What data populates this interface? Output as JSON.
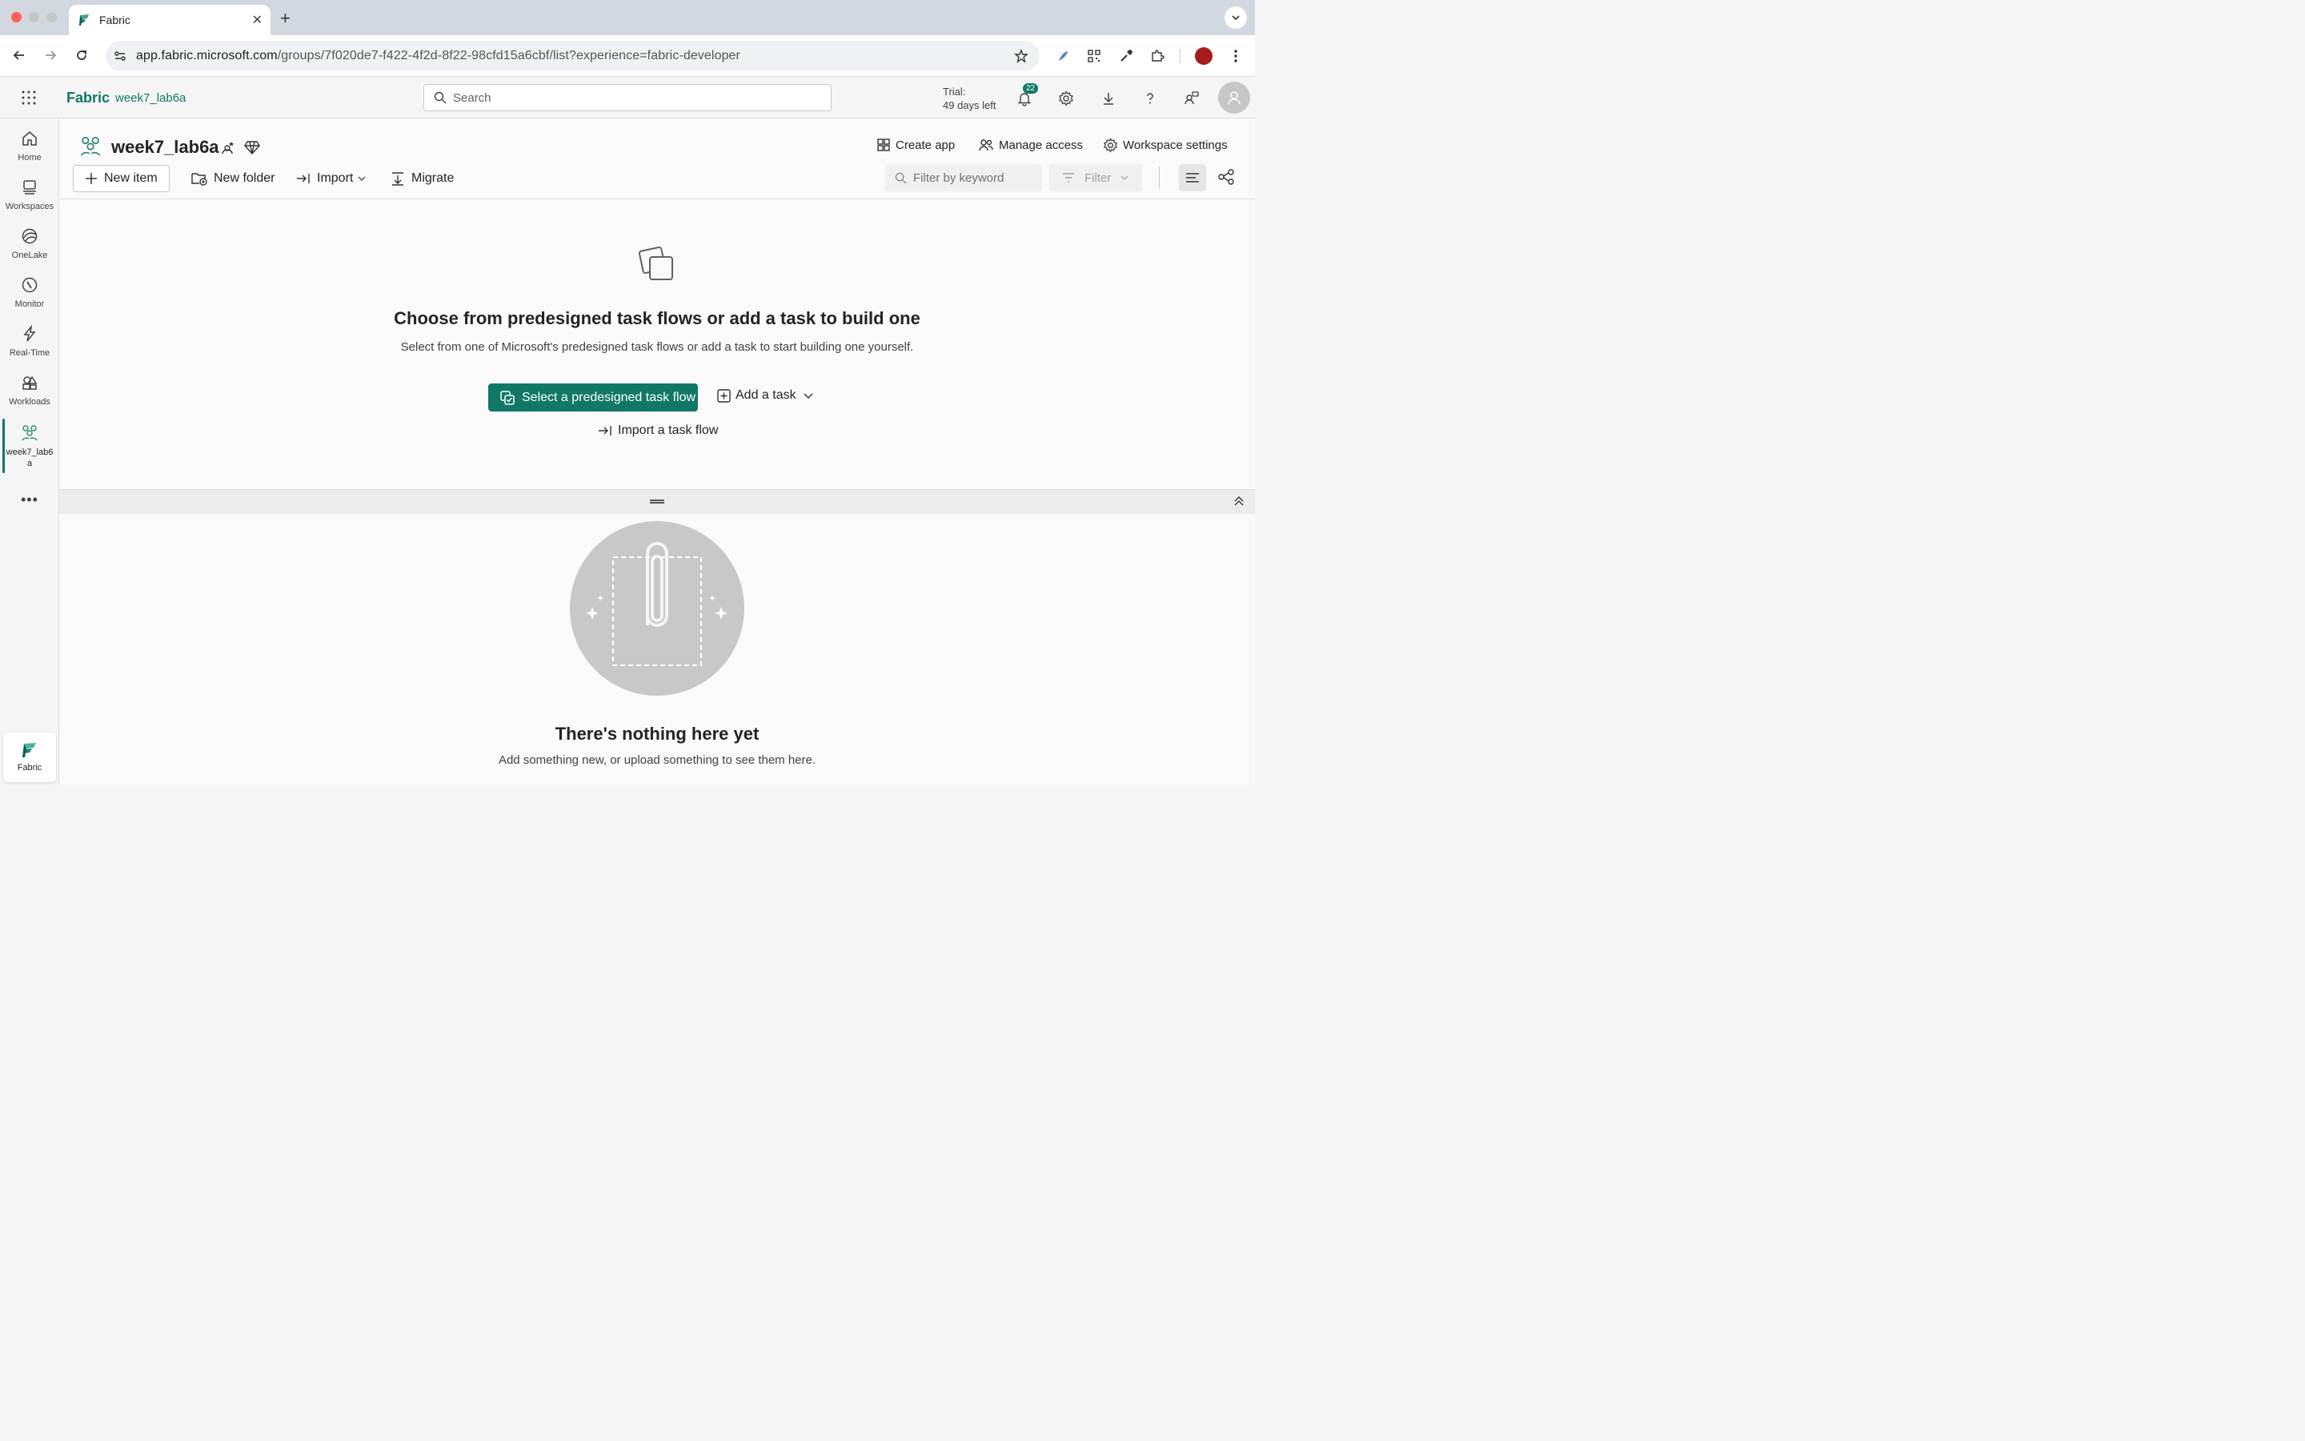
{
  "browser": {
    "tab_title": "Fabric",
    "tab_close": "✕",
    "new_tab": "+",
    "url_host": "app.fabric.microsoft.com",
    "url_path": "/groups/7f020de7-f422-4f2d-8f22-98cfd15a6cbf/list?experience=fabric-developer"
  },
  "header": {
    "brand": "Fabric",
    "breadcrumb": "week7_lab6a",
    "search_placeholder": "Search",
    "trial_line1": "Trial:",
    "trial_line2": "49 days left",
    "notification_count": "22"
  },
  "rail": {
    "items": [
      {
        "label": "Home",
        "icon": "home-icon"
      },
      {
        "label": "Workspaces",
        "icon": "workspaces-icon"
      },
      {
        "label": "OneLake",
        "icon": "onelake-icon"
      },
      {
        "label": "Monitor",
        "icon": "monitor-icon"
      },
      {
        "label": "Real-Time",
        "icon": "lightning-icon"
      },
      {
        "label": "Workloads",
        "icon": "workloads-icon"
      },
      {
        "label": "week7_lab6a",
        "icon": "workspace-icon"
      }
    ],
    "more": "•••",
    "footer_label": "Fabric"
  },
  "workspace": {
    "name": "week7_lab6a",
    "actions": {
      "create_app": "Create app",
      "manage_access": "Manage access",
      "workspace_settings": "Workspace settings"
    },
    "commands": {
      "new_item": "New item",
      "new_folder": "New folder",
      "import": "Import",
      "migrate": "Migrate"
    },
    "filter_placeholder": "Filter by keyword",
    "filter_label": "Filter"
  },
  "taskflow": {
    "title": "Choose from predesigned task flows or add a task to build one",
    "subtitle": "Select from one of Microsoft's predesigned task flows or add a task to start building one yourself.",
    "primary_button": "Select a predesigned task flow",
    "add_task": "Add a task",
    "import_flow": "Import a task flow"
  },
  "empty": {
    "title": "There's nothing here yet",
    "subtitle": "Add something new, or upload something to see them here."
  },
  "colors": {
    "accent": "#117865",
    "profile": "#a61b1b"
  }
}
